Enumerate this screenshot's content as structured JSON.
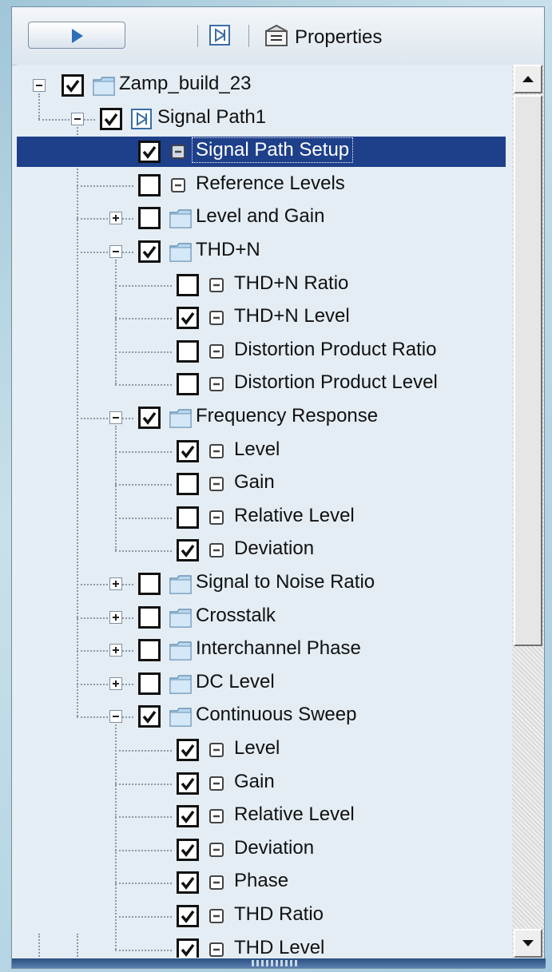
{
  "toolbar": {
    "properties_label": "Properties",
    "run_icon": "play-icon",
    "signal_path_icon": "signal-path-icon",
    "properties_icon": "properties-icon"
  },
  "colors": {
    "selection": "#1e3f8a",
    "tree_background": "#e4edf4",
    "folder": "#b9d7ee"
  },
  "tree": [
    {
      "level": 0,
      "label": "Zamp_build_23",
      "checked": true,
      "icon": "folder-icon",
      "expander": "minus"
    },
    {
      "level": 1,
      "label": "Signal Path1",
      "checked": true,
      "icon": "signal-path-icon",
      "expander": "minus"
    },
    {
      "level": 2,
      "label": "Signal Path Setup",
      "checked": true,
      "icon": "measurement-icon",
      "expander": null,
      "selected": true
    },
    {
      "level": 2,
      "label": "Reference Levels",
      "checked": false,
      "icon": "measurement-icon",
      "expander": null
    },
    {
      "level": 2,
      "label": "Level and Gain",
      "checked": false,
      "icon": "folder-icon",
      "expander": "plus"
    },
    {
      "level": 2,
      "label": "THD+N",
      "checked": true,
      "icon": "folder-icon",
      "expander": "minus"
    },
    {
      "level": 3,
      "label": "THD+N Ratio",
      "checked": false,
      "icon": "measurement-icon",
      "expander": null
    },
    {
      "level": 3,
      "label": "THD+N Level",
      "checked": true,
      "icon": "measurement-icon",
      "expander": null
    },
    {
      "level": 3,
      "label": "Distortion Product Ratio",
      "checked": false,
      "icon": "measurement-icon",
      "expander": null
    },
    {
      "level": 3,
      "label": "Distortion Product Level",
      "checked": false,
      "icon": "measurement-icon",
      "expander": null
    },
    {
      "level": 2,
      "label": "Frequency Response",
      "checked": true,
      "icon": "folder-icon",
      "expander": "minus"
    },
    {
      "level": 3,
      "label": "Level",
      "checked": true,
      "icon": "measurement-icon",
      "expander": null
    },
    {
      "level": 3,
      "label": "Gain",
      "checked": false,
      "icon": "measurement-icon",
      "expander": null
    },
    {
      "level": 3,
      "label": "Relative Level",
      "checked": false,
      "icon": "measurement-icon",
      "expander": null
    },
    {
      "level": 3,
      "label": "Deviation",
      "checked": true,
      "icon": "measurement-icon",
      "expander": null
    },
    {
      "level": 2,
      "label": "Signal to Noise Ratio",
      "checked": false,
      "icon": "folder-icon",
      "expander": "plus"
    },
    {
      "level": 2,
      "label": "Crosstalk",
      "checked": false,
      "icon": "folder-icon",
      "expander": "plus"
    },
    {
      "level": 2,
      "label": "Interchannel Phase",
      "checked": false,
      "icon": "folder-icon",
      "expander": "plus"
    },
    {
      "level": 2,
      "label": "DC Level",
      "checked": false,
      "icon": "folder-icon",
      "expander": "plus"
    },
    {
      "level": 2,
      "label": "Continuous Sweep",
      "checked": true,
      "icon": "folder-icon",
      "expander": "minus"
    },
    {
      "level": 3,
      "label": "Level",
      "checked": true,
      "icon": "measurement-icon",
      "expander": null
    },
    {
      "level": 3,
      "label": "Gain",
      "checked": true,
      "icon": "measurement-icon",
      "expander": null
    },
    {
      "level": 3,
      "label": "Relative Level",
      "checked": true,
      "icon": "measurement-icon",
      "expander": null
    },
    {
      "level": 3,
      "label": "Deviation",
      "checked": true,
      "icon": "measurement-icon",
      "expander": null
    },
    {
      "level": 3,
      "label": "Phase",
      "checked": true,
      "icon": "measurement-icon",
      "expander": null
    },
    {
      "level": 3,
      "label": "THD Ratio",
      "checked": true,
      "icon": "measurement-icon",
      "expander": null
    },
    {
      "level": 3,
      "label": "THD Level",
      "checked": true,
      "icon": "measurement-icon",
      "expander": null
    }
  ]
}
